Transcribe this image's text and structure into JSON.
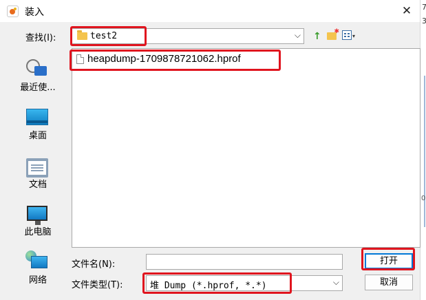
{
  "window": {
    "title": "装入",
    "close_glyph": "✕"
  },
  "background_fragments": [
    "7",
    "3",
    "0"
  ],
  "toolbar": {
    "look_in_label": "查找(I):",
    "look_in_value": "test2",
    "up_icon": "↑",
    "new_folder_star": "✱",
    "view_menu_arrow": "▾"
  },
  "places": [
    {
      "label": "最近使...",
      "icon": "recent-items-icon"
    },
    {
      "label": "桌面",
      "icon": "desktop-icon"
    },
    {
      "label": "文档",
      "icon": "documents-icon"
    },
    {
      "label": "此电脑",
      "icon": "this-pc-icon"
    },
    {
      "label": "网络",
      "icon": "network-icon"
    }
  ],
  "files": [
    {
      "name": "heapdump-1709878721062.hprof"
    }
  ],
  "footer": {
    "file_name_label": "文件名(N):",
    "file_name_value": "",
    "file_type_label": "文件类型(T):",
    "file_type_value": "堆 Dump (*.hprof, *.*)",
    "combo_arrow": "⌵",
    "open_button": "打开",
    "cancel_button": "取消"
  },
  "highlight_color": "#e0141e",
  "accent_color": "#0078d7"
}
